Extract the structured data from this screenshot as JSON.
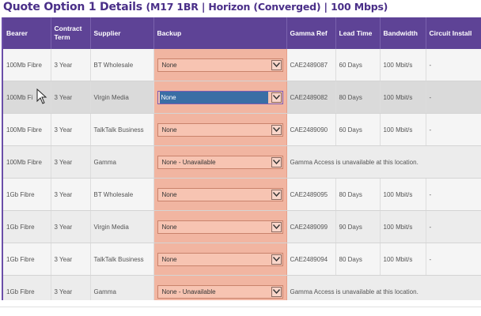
{
  "page": {
    "title": "Quote Option 1 Details",
    "subtitle": "(M17 1BR | Horizon (Converged) | 100 Mbps)"
  },
  "table": {
    "headers": {
      "bearer": "Bearer",
      "contract_term": "Contract Term",
      "supplier": "Supplier",
      "backup": "Backup",
      "gamma_ref": "Gamma Ref",
      "lead_time": "Lead Time",
      "bandwidth": "Bandwidth",
      "circuit_install": "Circuit Install"
    },
    "rows": [
      {
        "bearer": "100Mb Fibre",
        "term": "3 Year",
        "supplier": "BT Wholesale",
        "backup": "None",
        "gamma_ref": "CAE2489087",
        "lead_time": "60 Days",
        "bandwidth": "100 Mbit/s",
        "install": "-"
      },
      {
        "bearer": "100Mb Fi",
        "term": "3 Year",
        "supplier": "Virgin Media",
        "backup": "None",
        "gamma_ref": "CAE2489082",
        "lead_time": "80 Days",
        "bandwidth": "100 Mbit/s",
        "install": "-"
      },
      {
        "bearer": "100Mb Fibre",
        "term": "3 Year",
        "supplier": "TalkTalk Business",
        "backup": "None",
        "gamma_ref": "CAE2489090",
        "lead_time": "60 Days",
        "bandwidth": "100 Mbit/s",
        "install": "-"
      },
      {
        "bearer": "100Mb Fibre",
        "term": "3 Year",
        "supplier": "Gamma",
        "backup": "None - Unavailable",
        "note": "Gamma Access is unavailable at this location."
      },
      {
        "bearer": "1Gb Fibre",
        "term": "3 Year",
        "supplier": "BT Wholesale",
        "backup": "None",
        "gamma_ref": "CAE2489095",
        "lead_time": "80 Days",
        "bandwidth": "100 Mbit/s",
        "install": "-"
      },
      {
        "bearer": "1Gb Fibre",
        "term": "3 Year",
        "supplier": "Virgin Media",
        "backup": "None",
        "gamma_ref": "CAE2489099",
        "lead_time": "90 Days",
        "bandwidth": "100 Mbit/s",
        "install": "-"
      },
      {
        "bearer": "1Gb Fibre",
        "term": "3 Year",
        "supplier": "TalkTalk Business",
        "backup": "None",
        "gamma_ref": "CAE2489094",
        "lead_time": "80 Days",
        "bandwidth": "100 Mbit/s",
        "install": "-"
      },
      {
        "bearer": "1Gb Fibre",
        "term": "3 Year",
        "supplier": "Gamma",
        "backup": "None - Unavailable",
        "note": "Gamma Access is unavailable at this location."
      }
    ]
  },
  "colors": {
    "header_bg": "#5e4396",
    "title": "#4a2f88",
    "backup_highlight": "#f1b5a1",
    "selected_option": "#3a6ea5"
  }
}
